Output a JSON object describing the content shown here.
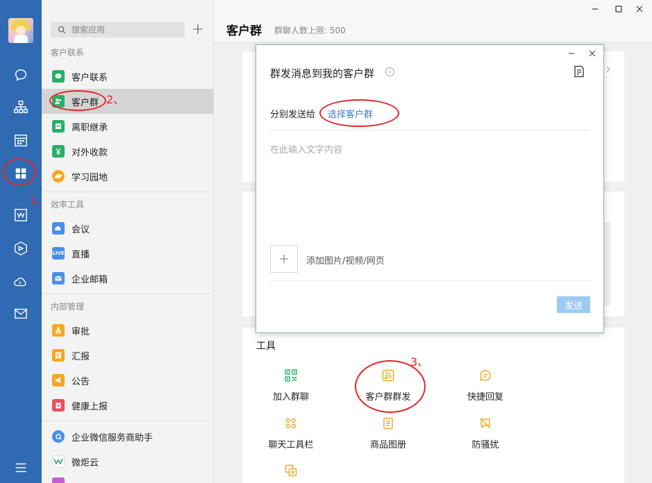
{
  "rail": {
    "icons": [
      "chat-icon",
      "org-chart-icon",
      "calendar-icon",
      "apps-grid-icon",
      "document-icon",
      "cube-icon",
      "cloud-phone-icon",
      "mail-icon",
      "menu-icon"
    ],
    "active": "apps-grid-icon",
    "accent": "#2f6ab3"
  },
  "sidebar": {
    "search_placeholder": "搜索应用",
    "add_label": "+",
    "sections": [
      {
        "title": "客户联系",
        "items": [
          {
            "label": "客户联系",
            "icon": "chat-bubble-icon",
            "color": "#2aae67"
          },
          {
            "label": "客户群",
            "icon": "group-icon",
            "color": "#2aae67"
          },
          {
            "label": "离职继承",
            "icon": "list-icon",
            "color": "#2aae67"
          },
          {
            "label": "对外收款",
            "icon": "yen-icon",
            "color": "#2aae67"
          },
          {
            "label": "学习园地",
            "icon": "planet-icon",
            "color": "#f5a623"
          }
        ]
      },
      {
        "title": "效率工具",
        "items": [
          {
            "label": "会议",
            "icon": "cloud-meeting-icon",
            "color": "#4a8fe7"
          },
          {
            "label": "直播",
            "icon": "live-icon",
            "color": "#4a8fe7",
            "badge": "LIVE"
          },
          {
            "label": "企业邮箱",
            "icon": "envelope-icon",
            "color": "#4a8fe7"
          }
        ]
      },
      {
        "title": "内部管理",
        "items": [
          {
            "label": "审批",
            "icon": "stamp-icon",
            "color": "#f5a623"
          },
          {
            "label": "汇报",
            "icon": "report-icon",
            "color": "#f5a623"
          },
          {
            "label": "公告",
            "icon": "megaphone-icon",
            "color": "#f5a623"
          },
          {
            "label": "健康上报",
            "icon": "health-icon",
            "color": "#e8505b"
          }
        ]
      },
      {
        "title": "",
        "items": [
          {
            "label": "企业微信服务商助手",
            "icon": "assistant-icon",
            "color": "#4a8fe7"
          },
          {
            "label": "微炬云",
            "icon": "weiju-logo-icon",
            "color": "#2aae67"
          }
        ]
      }
    ]
  },
  "main": {
    "title": "客户群",
    "subtitle": "群聊人数上限: 500",
    "tools_title": "工具",
    "tools": [
      {
        "label": "加入群聊",
        "icon": "qrcode-icon"
      },
      {
        "label": "客户群群发",
        "icon": "broadcast-icon"
      },
      {
        "label": "快捷回复",
        "icon": "quick-reply-icon"
      },
      {
        "label": "聊天工具栏",
        "icon": "toolbar-icon"
      },
      {
        "label": "商品图册",
        "icon": "catalog-icon"
      },
      {
        "label": "防骚扰",
        "icon": "anti-harass-icon"
      }
    ]
  },
  "dialog": {
    "title": "群发消息到我的客户群",
    "info": "i",
    "send_to_label": "分别发送给",
    "select_link": "选择客户群",
    "placeholder": "在此输入文字内容",
    "add_media_label": "添加图片/视频/网页",
    "send_label": "发送"
  },
  "annotations": {
    "step1": "1、",
    "step2": "2、",
    "step3": "3、",
    "color": "#e3262b"
  }
}
